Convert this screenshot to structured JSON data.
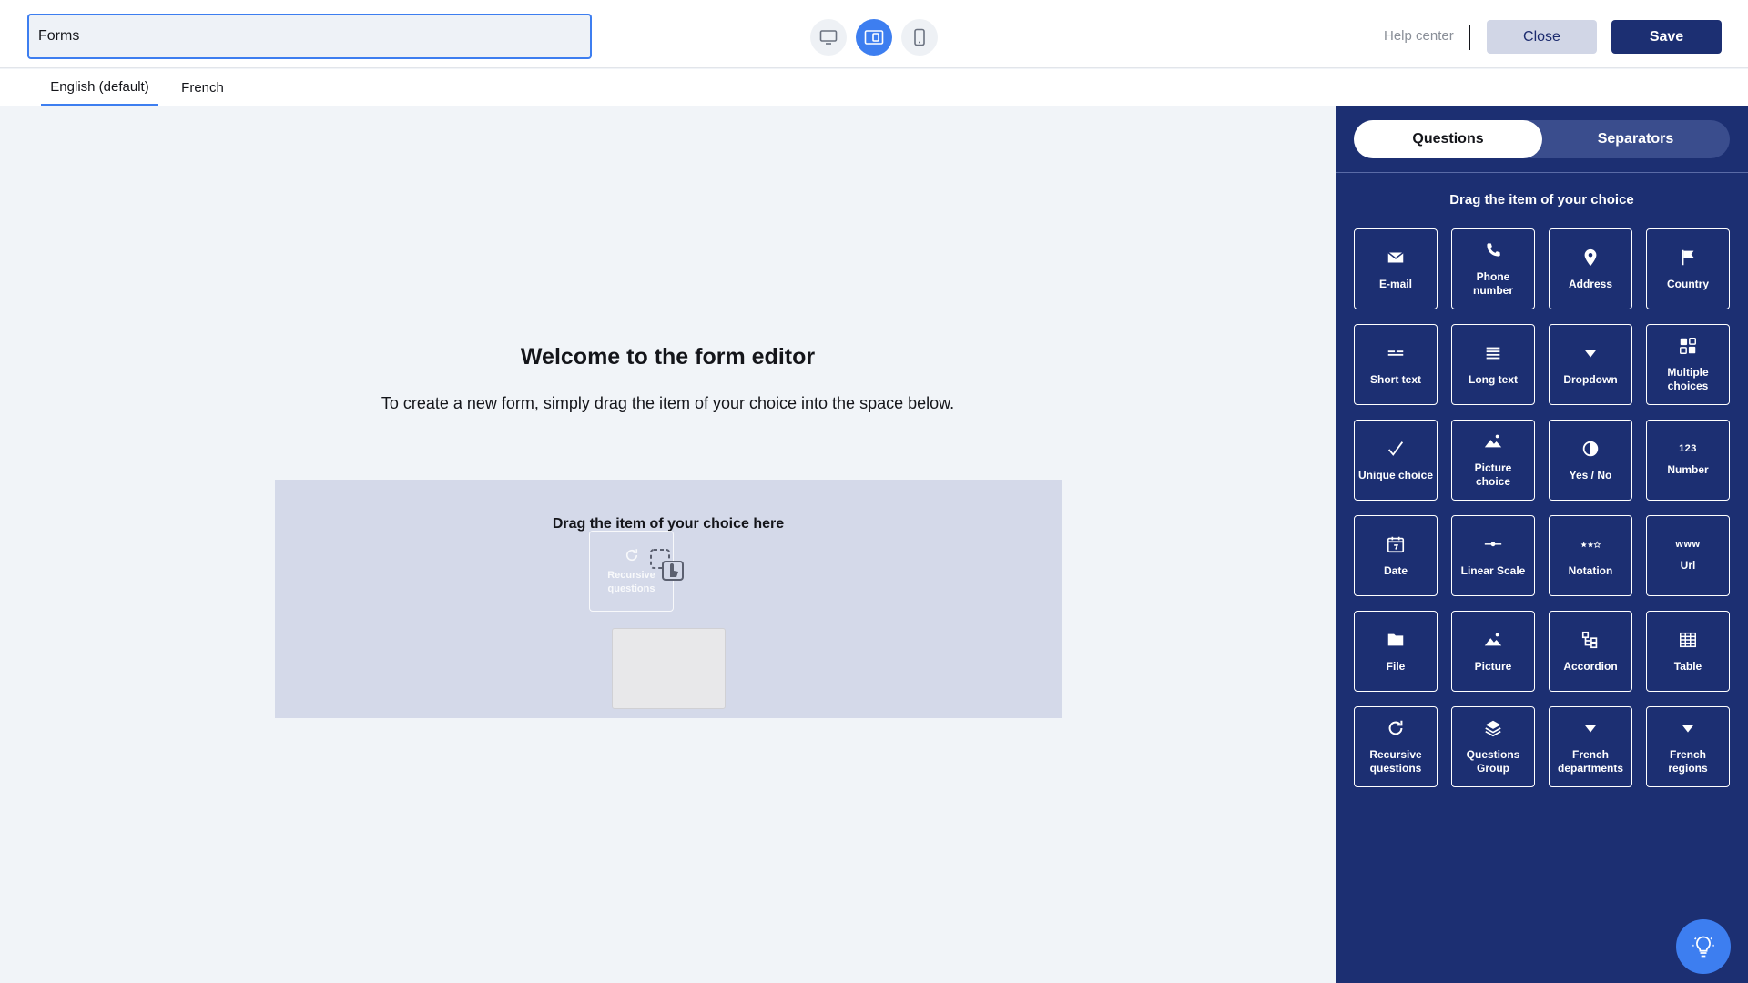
{
  "header": {
    "form_title_value": "Forms",
    "view_modes": [
      "desktop",
      "split",
      "mobile"
    ],
    "active_view": "split",
    "help_label": "Help center",
    "close_label": "Close",
    "save_label": "Save"
  },
  "languages": {
    "tabs": [
      {
        "label": "English (default)",
        "active": true
      },
      {
        "label": "French",
        "active": false
      }
    ]
  },
  "editor": {
    "title": "Welcome to the form editor",
    "subtitle": "To create a new form, simply drag the item of your choice into the space below.",
    "dropzone_label": "Drag the item of your choice here",
    "dragged_item_label": "Recursive questions"
  },
  "panel": {
    "tabs": [
      {
        "label": "Questions",
        "active": true
      },
      {
        "label": "Separators",
        "active": false
      }
    ],
    "hint": "Drag the item of your choice",
    "items": [
      {
        "label": "E-mail",
        "icon": "mail-icon"
      },
      {
        "label": "Phone number",
        "icon": "phone-icon"
      },
      {
        "label": "Address",
        "icon": "map-pin-icon"
      },
      {
        "label": "Country",
        "icon": "flag-icon"
      },
      {
        "label": "Short text",
        "icon": "short-text-icon"
      },
      {
        "label": "Long text",
        "icon": "long-text-icon"
      },
      {
        "label": "Dropdown",
        "icon": "dropdown-icon"
      },
      {
        "label": "Multiple choices",
        "icon": "multiple-choices-icon"
      },
      {
        "label": "Unique choice",
        "icon": "check-icon"
      },
      {
        "label": "Picture choice",
        "icon": "landscape-icon"
      },
      {
        "label": "Yes / No",
        "icon": "half-circle-icon"
      },
      {
        "label": "Number",
        "icon": "number-icon",
        "glyph": "123"
      },
      {
        "label": "Date",
        "icon": "calendar-icon"
      },
      {
        "label": "Linear Scale",
        "icon": "linear-scale-icon"
      },
      {
        "label": "Notation",
        "icon": "stars-icon"
      },
      {
        "label": "Url",
        "icon": "www-icon",
        "glyph": "www"
      },
      {
        "label": "File",
        "icon": "folder-icon"
      },
      {
        "label": "Picture",
        "icon": "landscape-icon"
      },
      {
        "label": "Accordion",
        "icon": "accordion-icon"
      },
      {
        "label": "Table",
        "icon": "table-icon"
      },
      {
        "label": "Recursive questions",
        "icon": "refresh-icon"
      },
      {
        "label": "Questions Group",
        "icon": "layers-icon"
      },
      {
        "label": "French departments",
        "icon": "dropdown-icon"
      },
      {
        "label": "French regions",
        "icon": "dropdown-icon"
      }
    ]
  },
  "colors": {
    "accent": "#3d7ef0",
    "panel_bg": "#1c2f72",
    "dropzone_bg": "#d4d9e9",
    "canvas_bg": "#f1f4f8"
  }
}
